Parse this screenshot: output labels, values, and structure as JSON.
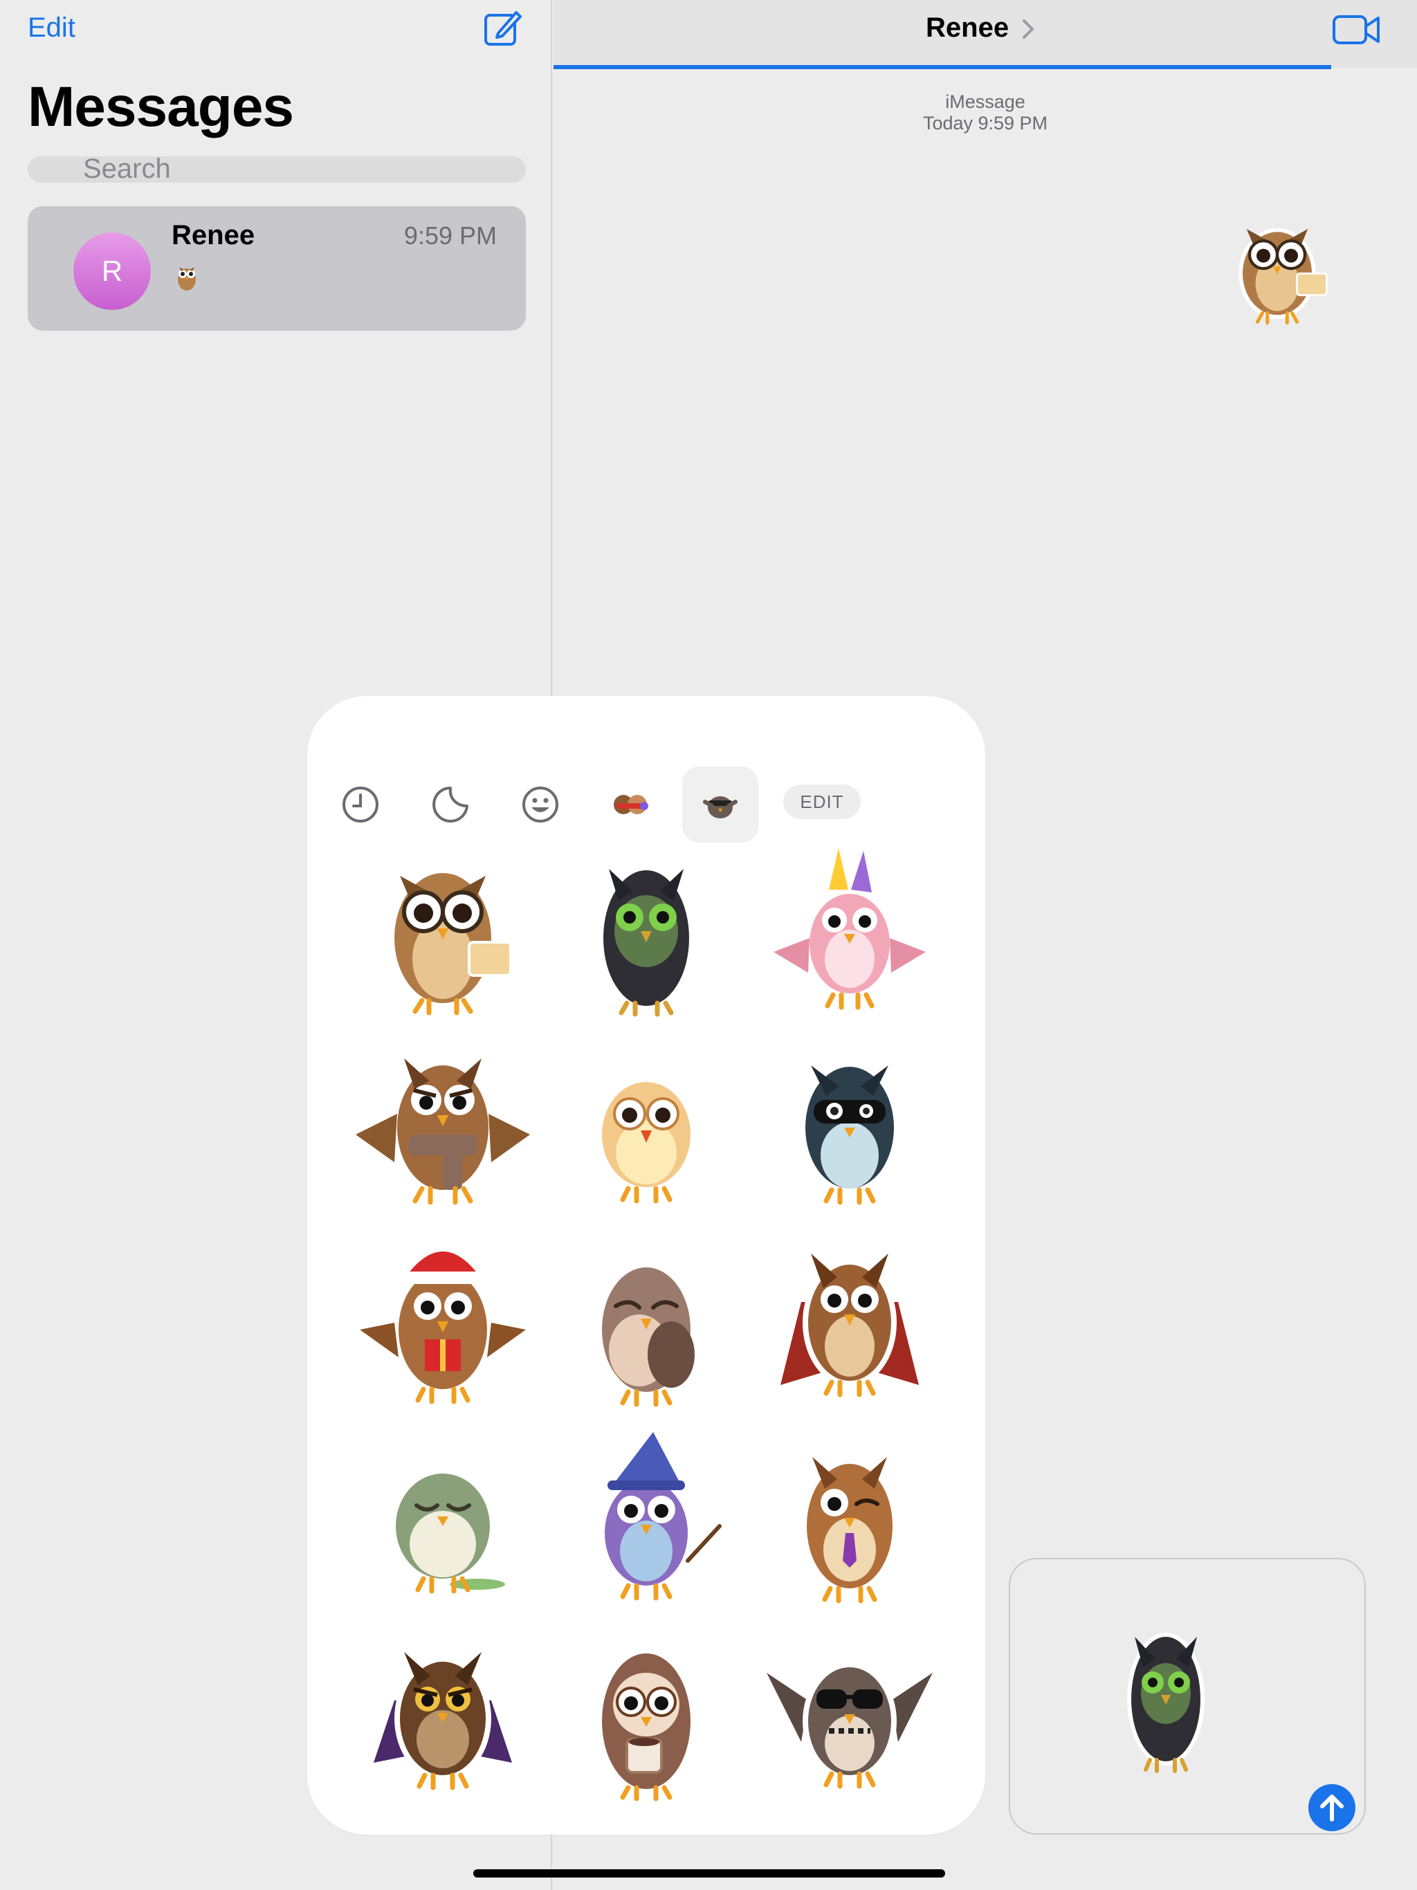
{
  "sidebar": {
    "edit_label": "Edit",
    "title": "Messages",
    "search_placeholder": "Search",
    "conversations": [
      {
        "name": "Renee",
        "avatar_initial": "R",
        "time": "9:59 PM",
        "preview_icon": "owl-sticker-icon"
      }
    ]
  },
  "conversation": {
    "contact_name": "Renee",
    "service_label": "iMessage",
    "timestamp": "Today 9:59 PM",
    "sent_sticker": "owl-glasses-sticker"
  },
  "sticker_panel": {
    "tabs": [
      {
        "name": "recents-tab",
        "icon": "clock-icon"
      },
      {
        "name": "stickers-tab",
        "icon": "sticker-peel-icon"
      },
      {
        "name": "emoji-tab",
        "icon": "smiley-icon"
      },
      {
        "name": "memoji-tab",
        "icon": "memoji-icon"
      },
      {
        "name": "owl-pack-tab",
        "icon": "owl-pack-icon",
        "selected": true
      }
    ],
    "edit_label": "EDIT",
    "stickers": [
      "owl-glasses-sticker",
      "owl-green-eyes-sticker",
      "owl-party-hat-sticker",
      "owl-scarf-sticker",
      "owl-cream-sticker",
      "owl-masked-sticker",
      "owl-santa-hat-sticker",
      "owl-sleepy-sticker",
      "owl-caped-sticker",
      "owl-green-sleeping-sticker",
      "owl-wizard-sticker",
      "owl-winking-sticker",
      "owl-dark-caped-sticker",
      "owl-coffee-sticker",
      "owl-sunglasses-sticker"
    ]
  },
  "compose": {
    "pending_sticker": "owl-green-eyes-sticker",
    "send_icon": "send-arrow-icon"
  },
  "colors": {
    "accent": "#1a73e8",
    "avatar": "#d57be0",
    "background": "#ececec"
  }
}
